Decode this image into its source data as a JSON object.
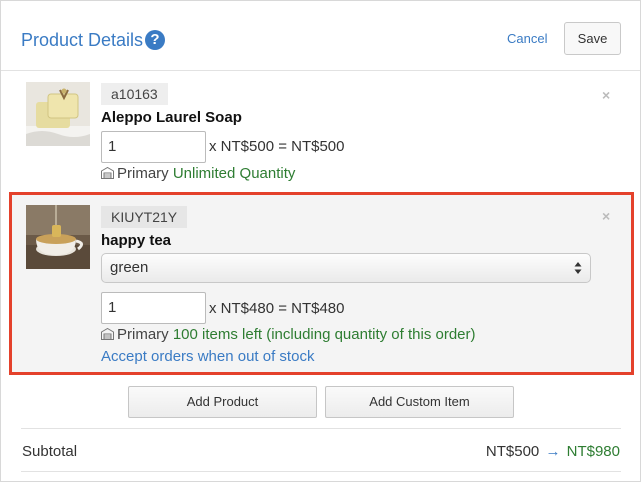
{
  "header": {
    "title": "Product Details",
    "help_icon": "?",
    "cancel_label": "Cancel",
    "save_label": "Save"
  },
  "items": [
    {
      "sku": "a10163",
      "name": "Aleppo Laurel Soap",
      "quantity": "1",
      "price_line": "x NT$500 = NT$500",
      "stock_prefix": "Primary",
      "stock_status": "Unlimited Quantity",
      "remove_icon": "×"
    },
    {
      "sku": "KIUYT21Y",
      "name": "happy tea",
      "variant": "green",
      "quantity": "1",
      "price_line": "x NT$480 = NT$480",
      "stock_prefix": "Primary",
      "stock_status": "100 items left (including quantity of this order)",
      "accept_link": "Accept orders when out of stock",
      "remove_icon": "×"
    }
  ],
  "actions": {
    "add_product": "Add Product",
    "add_custom": "Add Custom Item"
  },
  "subtotal": {
    "label": "Subtotal",
    "old": "NT$500",
    "arrow": "→",
    "new": "NT$980"
  },
  "colors": {
    "accent": "#3a7bc4",
    "highlight_border": "#e4412b",
    "stock_green": "#2e7d32"
  }
}
